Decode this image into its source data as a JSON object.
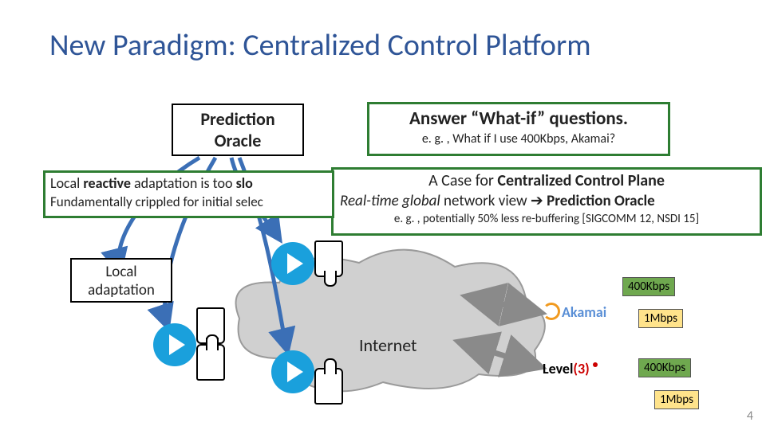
{
  "title": "New Paradigm: Centralized Control Platform",
  "prediction_oracle": {
    "line1": "Prediction",
    "line2": "Oracle"
  },
  "whatif": {
    "headline": "Answer “What-if” questions.",
    "example": "e. g. , What if I use 400Kbps, Akamai?"
  },
  "local_reactive": {
    "l1_prefix": "Local ",
    "l1_bold1": "reactive",
    "l1_mid": " adaptation is too ",
    "l1_bold2": "slo",
    "l2": "Fundamentally crippled for initial selec"
  },
  "case_box": {
    "c1_prefix": "A Case for ",
    "c1_bold": "Centralized Control Plane",
    "c2_italic": "Real-time global",
    "c2_mid": " network view ",
    "c2_arrow": "➔",
    "c2_bold": " Prediction Oracle",
    "c3": "e. g. , potentially 50% less re-buffering [SIGCOMM 12, NSDI 15]"
  },
  "local_adapt": {
    "l1": "Local",
    "l2": "adaptation"
  },
  "internet": "Internet",
  "badges": {
    "b400": "400Kbps",
    "b1m": "1Mbps"
  },
  "logos": {
    "akamai": "Akamai",
    "level3_a": "Level",
    "level3_b": "(3)"
  },
  "page_number": "4"
}
